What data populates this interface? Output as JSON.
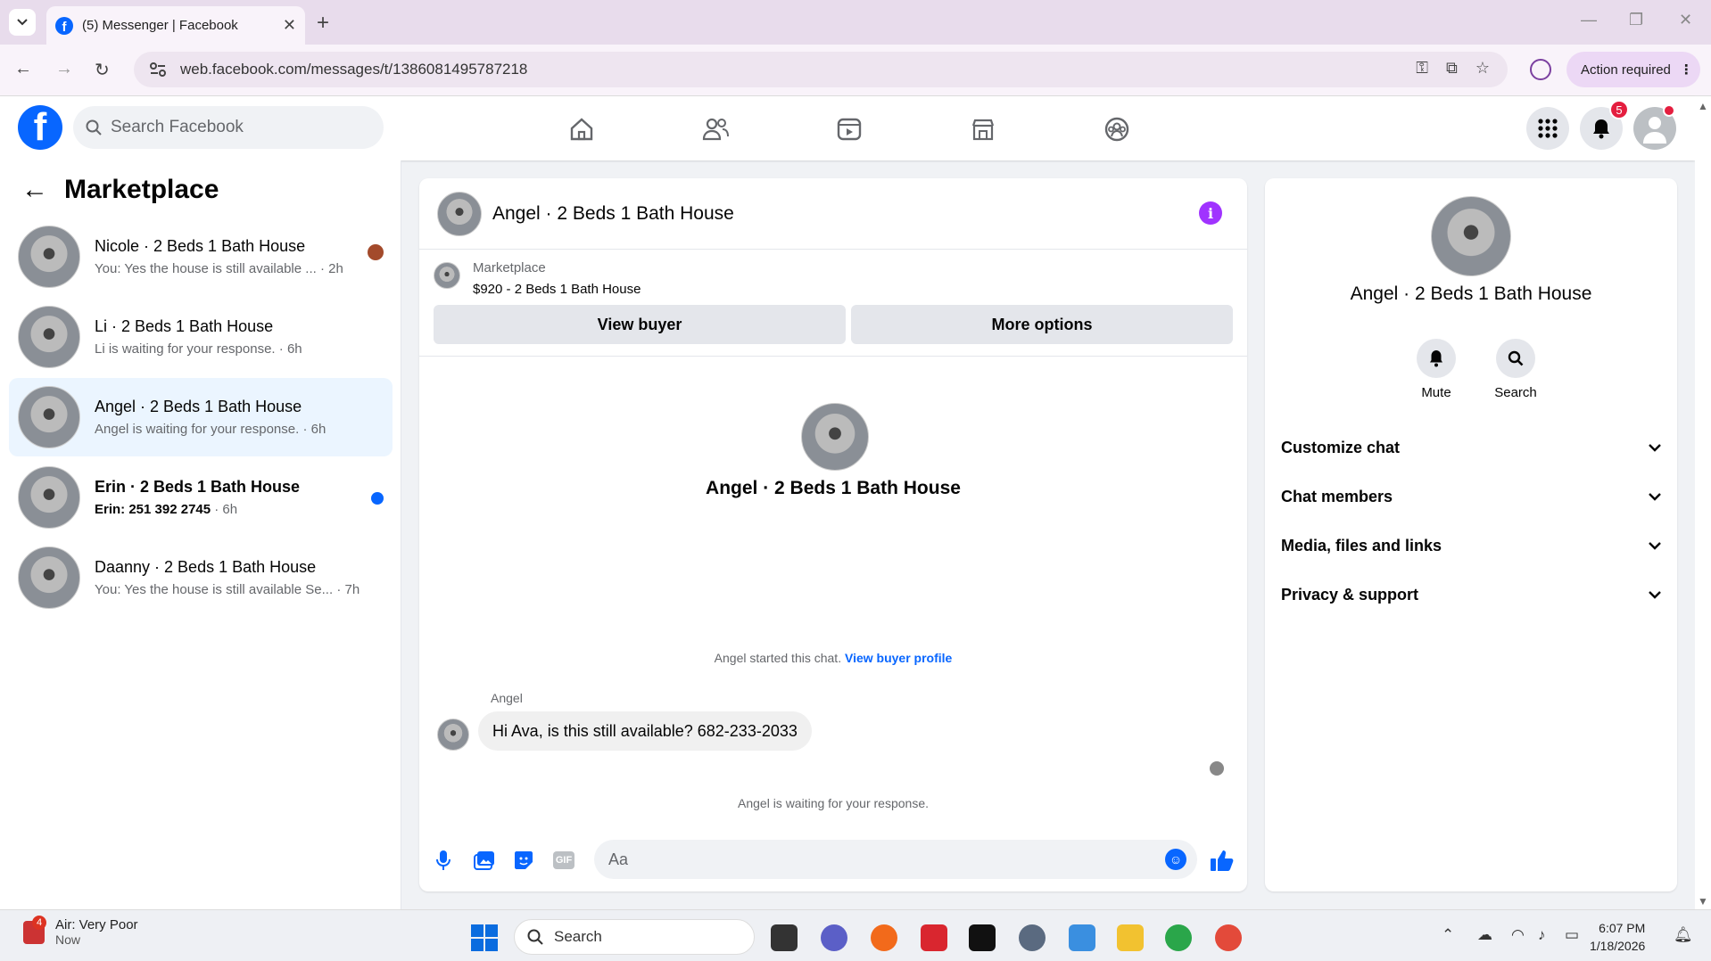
{
  "browser": {
    "tab_title": "(5) Messenger | Facebook",
    "url": "web.facebook.com/messages/t/1386081495787218",
    "action_required": "Action required"
  },
  "fb_header": {
    "search_placeholder": "Search Facebook",
    "notification_count": "5"
  },
  "left_panel": {
    "title": "Marketplace",
    "conversations": [
      {
        "name": "Nicole · 2 Beds 1 Bath House",
        "preview": "You: Yes the house is still available ...",
        "time": "· 2h",
        "unread": false,
        "active": false
      },
      {
        "name": "Li · 2 Beds 1 Bath House",
        "preview": "Li is waiting for your response.",
        "time": "· 6h",
        "unread": false,
        "active": false
      },
      {
        "name": "Angel · 2 Beds 1 Bath House",
        "preview": "Angel is waiting for your response.",
        "time": "· 6h",
        "unread": false,
        "active": true
      },
      {
        "name": "Erin · 2 Beds 1 Bath House",
        "preview": "Erin: 251 392 2745",
        "time": "· 6h",
        "unread": true,
        "active": false
      },
      {
        "name": "Daanny · 2 Beds 1 Bath House",
        "preview": "You: Yes the house is still available Se...",
        "time": "· 7h",
        "unread": false,
        "active": false
      }
    ]
  },
  "chat": {
    "title": "Angel · 2 Beds 1 Bath House",
    "marketplace_label": "Marketplace",
    "listing": "$920 - 2 Beds 1 Bath House",
    "view_buyer": "View buyer",
    "more_options": "More options",
    "intro_name": "Angel · 2 Beds 1 Bath House",
    "started_text": "Angel started this chat.",
    "view_buyer_profile": "View buyer profile",
    "sender": "Angel",
    "message": "Hi Ava, is this still available? 682-233-2033",
    "waiting": "Angel is waiting for your response.",
    "composer_placeholder": "Aa",
    "gif_label": "GIF"
  },
  "info_panel": {
    "name": "Angel · 2 Beds 1 Bath House",
    "mute": "Mute",
    "search": "Search",
    "sections": [
      "Customize chat",
      "Chat members",
      "Media, files and links",
      "Privacy & support"
    ]
  },
  "taskbar": {
    "weather_title": "Air: Very Poor",
    "weather_sub": "Now",
    "weather_badge": "4",
    "search_placeholder": "Search",
    "time": "6:07 PM",
    "date": "1/18/2026"
  }
}
